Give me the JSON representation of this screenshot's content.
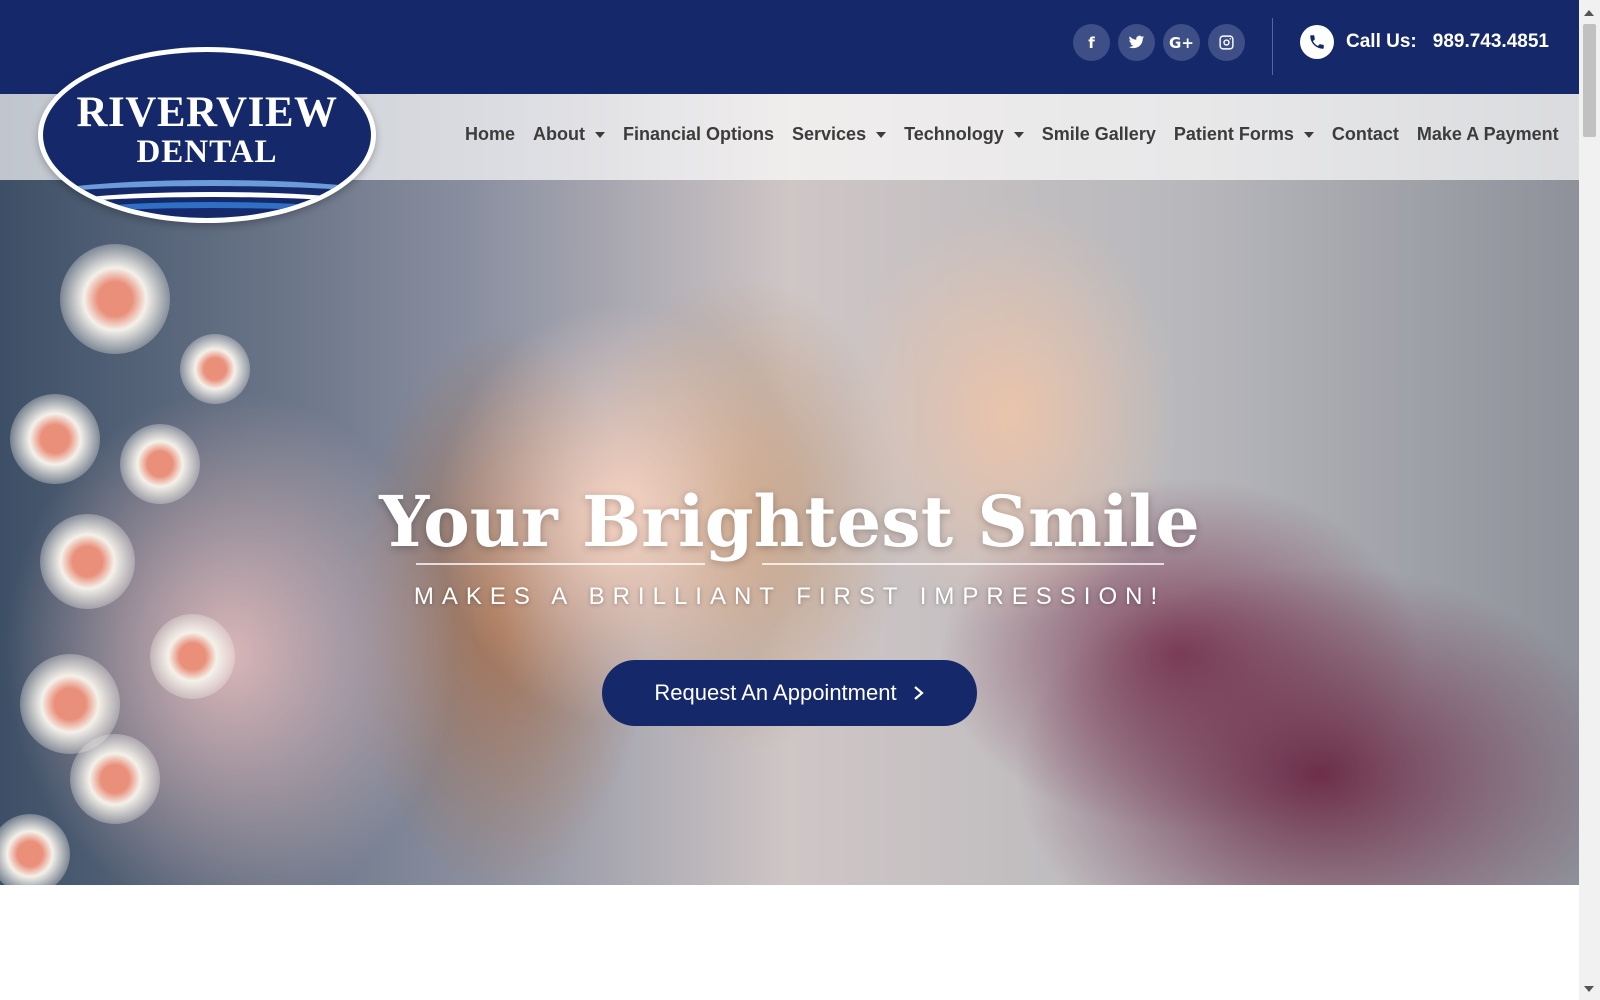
{
  "logo": {
    "line1": "RIVERVIEW",
    "line2": "DENTAL"
  },
  "topbar": {
    "socials": [
      {
        "icon": "facebook-icon",
        "glyph": "f"
      },
      {
        "icon": "twitter-icon",
        "glyph": ""
      },
      {
        "icon": "google-plus-icon",
        "glyph": "G+"
      },
      {
        "icon": "instagram-icon",
        "glyph": ""
      }
    ],
    "call_label": "Call Us:",
    "phone": "989.743.4851"
  },
  "nav": {
    "items": [
      {
        "label": "Home",
        "dropdown": false
      },
      {
        "label": "About",
        "dropdown": true
      },
      {
        "label": "Financial Options",
        "dropdown": false
      },
      {
        "label": "Services",
        "dropdown": true
      },
      {
        "label": "Technology",
        "dropdown": true
      },
      {
        "label": "Smile Gallery",
        "dropdown": false
      },
      {
        "label": "Patient Forms",
        "dropdown": true
      },
      {
        "label": "Contact",
        "dropdown": false
      },
      {
        "label": "Make A Payment",
        "dropdown": false
      }
    ]
  },
  "hero": {
    "headline": "Your Brightest Smile",
    "subheadline": "MAKES A BRILLIANT FIRST IMPRESSION!",
    "cta_label": "Request An Appointment"
  },
  "colors": {
    "brand_navy": "#15296a",
    "social_circle": "#3e4e86",
    "nav_text": "#3c3c3c"
  }
}
